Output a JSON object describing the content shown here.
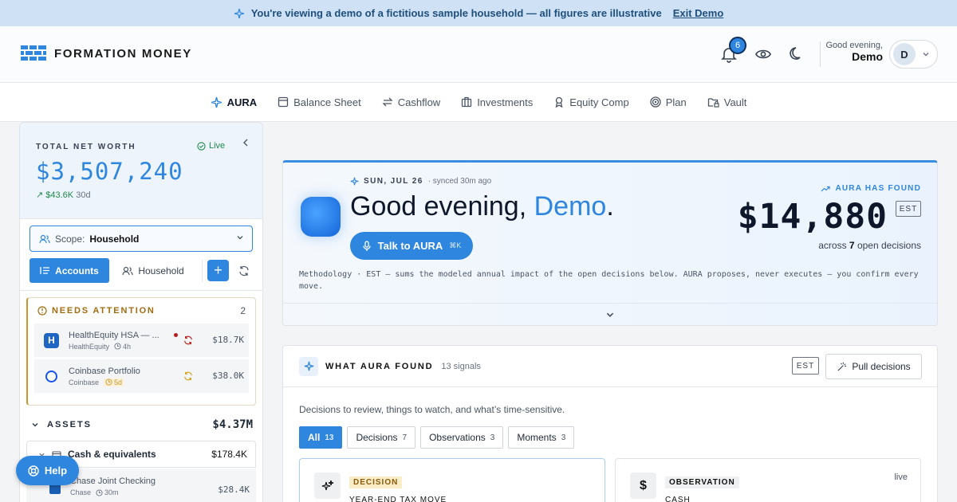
{
  "banner": {
    "text": "You're viewing a demo of a fictitious sample household — all figures are illustrative",
    "link": "Exit Demo"
  },
  "header": {
    "brand": "FORMATION MONEY",
    "notifications": "6",
    "greeting": "Good evening,",
    "user": "Demo",
    "avatar": "D"
  },
  "nav": [
    {
      "label": "AURA",
      "icon": "sparkle-icon"
    },
    {
      "label": "Balance Sheet",
      "icon": "ledger-icon"
    },
    {
      "label": "Cashflow",
      "icon": "arrows-icon"
    },
    {
      "label": "Investments",
      "icon": "briefcase-icon"
    },
    {
      "label": "Equity Comp",
      "icon": "award-icon"
    },
    {
      "label": "Plan",
      "icon": "target-icon"
    },
    {
      "label": "Vault",
      "icon": "folder-lock-icon"
    }
  ],
  "sidebar": {
    "net_worth_label": "TOTAL NET WORTH",
    "live": "Live",
    "net_worth": "$3,507,240",
    "delta": "↗ $43.6K",
    "delta_period": "30d",
    "scope_label": "Scope:",
    "scope_value": "Household",
    "accounts_tab": "Accounts",
    "household_tab": "Household",
    "needs_title": "NEEDS ATTENTION",
    "needs_count": "2",
    "attention": [
      {
        "name": "HealthEquity HSA — ...",
        "institution": "HealthEquity",
        "age": "4h",
        "value": "$18.7K",
        "logo": "H"
      },
      {
        "name": "Coinbase Portfolio",
        "institution": "Coinbase",
        "age": "5d",
        "value": "$38.0K",
        "logo": "C"
      }
    ],
    "assets_title": "ASSETS",
    "assets_total": "$4.37M",
    "cash_label": "Cash & equivalents",
    "cash_total": "$178.4K",
    "chase": {
      "name": "Chase Joint Checking",
      "institution": "Chase",
      "age": "30m",
      "value": "$28.4K"
    }
  },
  "help": "Help",
  "hero": {
    "date": "SUN, JUL 26",
    "synced": "· synced 30m ago",
    "hello": "Good evening, ",
    "name": "Demo",
    "period": ".",
    "talk": "Talk to AURA",
    "shortcut": "⌘K",
    "found_label": "AURA HAS FOUND",
    "amount": "$14,880",
    "est": "EST",
    "across_pre": "across",
    "across_n": "7",
    "across_post": "open decisions",
    "methodology": "Methodology · EST — sums the modeled annual impact of the open decisions below. AURA proposes, never executes — you confirm every move."
  },
  "panel": {
    "title": "WHAT AURA FOUND",
    "signals": "13 signals",
    "est": "EST",
    "pull": "Pull decisions",
    "desc": "Decisions to review, things to watch, and what’s time-sensitive.",
    "filters": [
      {
        "label": "All",
        "count": "13"
      },
      {
        "label": "Decisions",
        "count": "7"
      },
      {
        "label": "Observations",
        "count": "3"
      },
      {
        "label": "Moments",
        "count": "3"
      }
    ],
    "cards": [
      {
        "tag": "DECISION",
        "sub": "YEAR-END TAX MOVE"
      },
      {
        "tag": "OBSERVATION",
        "sub": "CASH",
        "live": "live"
      }
    ]
  },
  "colors": {
    "accent": "#2e86de",
    "attention": "#c9962b",
    "positive": "#1f8a4c"
  }
}
